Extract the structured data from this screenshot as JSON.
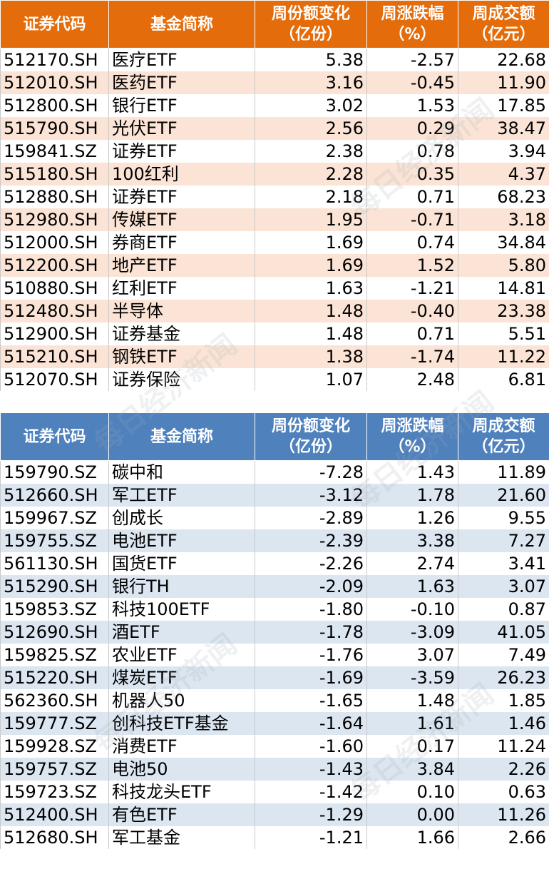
{
  "headers": {
    "code": "证券代码",
    "name": "基金简称",
    "share_change": [
      "周份额变化",
      "（亿份）"
    ],
    "change_pct": [
      "周涨跌幅",
      "（%）"
    ],
    "turnover": [
      "周成交额",
      "（亿元）"
    ]
  },
  "top_table": {
    "rows": [
      [
        "512170.SH",
        "医疗ETF",
        "5.38",
        "-2.57",
        "22.68"
      ],
      [
        "512010.SH",
        "医药ETF",
        "3.16",
        "-0.45",
        "11.90"
      ],
      [
        "512800.SH",
        "银行ETF",
        "3.02",
        "1.53",
        "17.85"
      ],
      [
        "515790.SH",
        "光伏ETF",
        "2.56",
        "0.29",
        "38.47"
      ],
      [
        "159841.SZ",
        "证券ETF",
        "2.38",
        "0.78",
        "3.94"
      ],
      [
        "515180.SH",
        "100红利",
        "2.28",
        "0.35",
        "4.37"
      ],
      [
        "512880.SH",
        "证券ETF",
        "2.18",
        "0.71",
        "68.23"
      ],
      [
        "512980.SH",
        "传媒ETF",
        "1.95",
        "-0.71",
        "3.18"
      ],
      [
        "512000.SH",
        "券商ETF",
        "1.69",
        "0.74",
        "34.84"
      ],
      [
        "512200.SH",
        "地产ETF",
        "1.69",
        "1.52",
        "5.80"
      ],
      [
        "510880.SH",
        "红利ETF",
        "1.63",
        "-1.21",
        "14.81"
      ],
      [
        "512480.SH",
        "半导体",
        "1.48",
        "-0.40",
        "23.38"
      ],
      [
        "512900.SH",
        "证券基金",
        "1.48",
        "0.71",
        "5.51"
      ],
      [
        "515210.SH",
        "钢铁ETF",
        "1.38",
        "-1.74",
        "11.22"
      ],
      [
        "512070.SH",
        "证券保险",
        "1.07",
        "2.48",
        "6.81"
      ]
    ]
  },
  "bottom_table": {
    "rows": [
      [
        "159790.SZ",
        "碳中和",
        "-7.28",
        "1.43",
        "11.89"
      ],
      [
        "512660.SH",
        "军工ETF",
        "-3.12",
        "1.78",
        "21.60"
      ],
      [
        "159967.SZ",
        "创成长",
        "-2.89",
        "1.26",
        "9.55"
      ],
      [
        "159755.SZ",
        "电池ETF",
        "-2.39",
        "3.38",
        "7.27"
      ],
      [
        "561130.SH",
        "国货ETF",
        "-2.26",
        "2.74",
        "3.41"
      ],
      [
        "515290.SH",
        "银行TH",
        "-2.09",
        "1.63",
        "3.07"
      ],
      [
        "159853.SZ",
        "科技100ETF",
        "-1.80",
        "-0.10",
        "0.87"
      ],
      [
        "512690.SH",
        "酒ETF",
        "-1.78",
        "-3.09",
        "41.05"
      ],
      [
        "159825.SZ",
        "农业ETF",
        "-1.76",
        "3.07",
        "7.49"
      ],
      [
        "515220.SH",
        "煤炭ETF",
        "-1.69",
        "-3.59",
        "26.23"
      ],
      [
        "562360.SH",
        "机器人50",
        "-1.65",
        "1.48",
        "1.85"
      ],
      [
        "159777.SZ",
        "创科技ETF基金",
        "-1.64",
        "1.61",
        "1.46"
      ],
      [
        "159928.SZ",
        "消费ETF",
        "-1.60",
        "0.17",
        "11.24"
      ],
      [
        "159757.SZ",
        "电池50",
        "-1.43",
        "3.84",
        "2.26"
      ],
      [
        "159723.SZ",
        "科技龙头ETF",
        "-1.42",
        "0.10",
        "0.63"
      ],
      [
        "512400.SH",
        "有色ETF",
        "-1.29",
        "0.00",
        "11.26"
      ],
      [
        "512680.SH",
        "军工基金",
        "-1.21",
        "1.66",
        "2.66"
      ]
    ]
  },
  "watermark": "每日经济新闻",
  "colors": {
    "top_header": "#e46c0a",
    "top_stripe": "#fbe4d5",
    "bottom_header": "#4f81bd",
    "bottom_stripe": "#dce6f1"
  }
}
